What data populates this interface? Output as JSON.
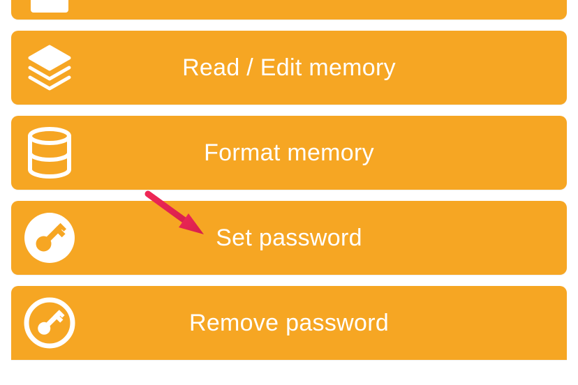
{
  "menu": {
    "items": [
      {
        "label": ""
      },
      {
        "label": "Read / Edit memory"
      },
      {
        "label": "Format memory"
      },
      {
        "label": "Set password"
      },
      {
        "label": "Remove password"
      }
    ]
  },
  "icons": {
    "layers": "layers-icon",
    "database": "database-icon",
    "key": "key-icon",
    "keyOutline": "key-outline-icon",
    "lock": "lock-icon"
  },
  "annotation": {
    "arrow_color": "#ef2757",
    "target_item_index": 3
  },
  "colors": {
    "accent": "#f6a623",
    "text": "#ffffff"
  }
}
